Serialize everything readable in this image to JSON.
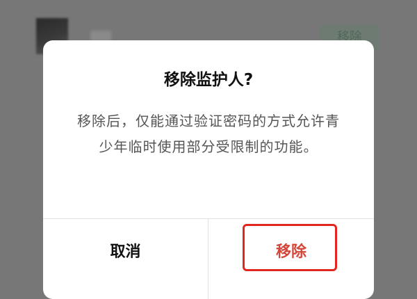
{
  "background": {
    "row_action_label": "移除"
  },
  "dialog": {
    "title": "移除监护人?",
    "message": "移除后，仅能通过验证密码的方式允许青少年临时使用部分受限制的功能。",
    "cancel_label": "取消",
    "confirm_label": "移除"
  },
  "colors": {
    "overlay": "#777777",
    "dialog_background": "#ffffff",
    "confirm_text": "#d5463a",
    "highlight_border": "#e0261e"
  }
}
